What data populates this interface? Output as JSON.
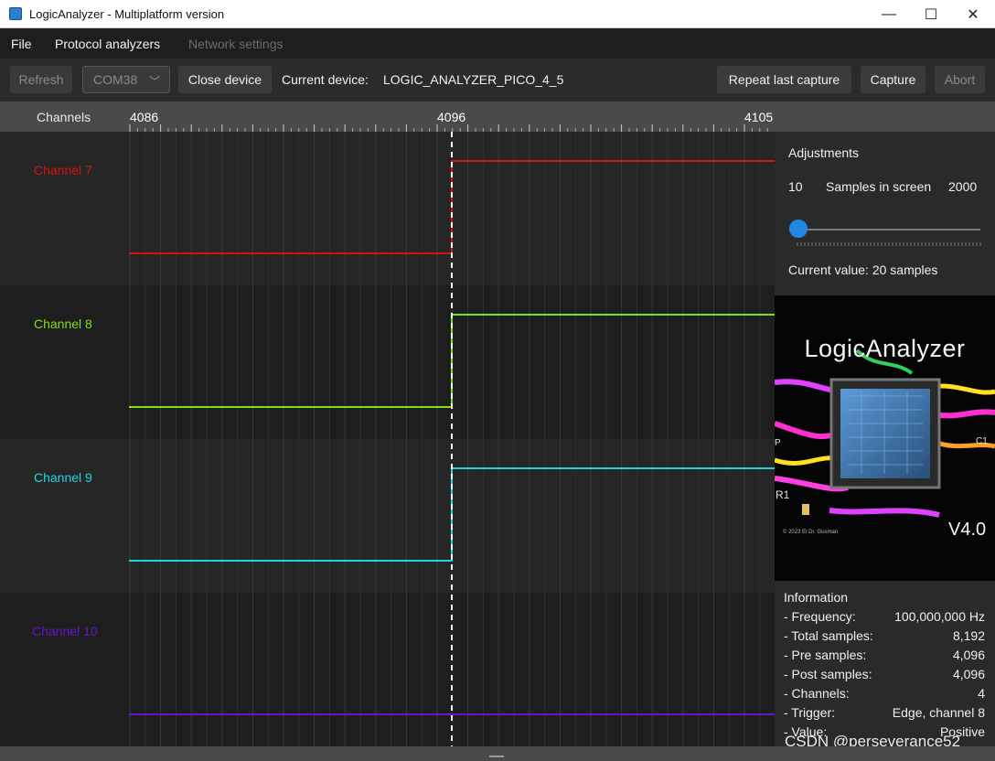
{
  "window": {
    "title": "LogicAnalyzer - Multiplatform version",
    "controls": {
      "minimize": "—",
      "maximize": "☐",
      "close": "✕"
    }
  },
  "menu": {
    "items": [
      {
        "label": "File",
        "enabled": true
      },
      {
        "label": "Protocol analyzers",
        "enabled": true
      },
      {
        "label": "Network settings",
        "enabled": false
      }
    ]
  },
  "toolbar": {
    "refresh_label": "Refresh",
    "port_value": "COM38",
    "close_device_label": "Close device",
    "current_device_label": "Current device:",
    "current_device_value": "LOGIC_ANALYZER_PICO_4_5",
    "repeat_capture_label": "Repeat last capture",
    "capture_label": "Capture",
    "abort_label": "Abort"
  },
  "ruler": {
    "channels_header": "Channels",
    "tick_labels": [
      "4086",
      "4096",
      "4105"
    ]
  },
  "channels": [
    {
      "label": "Channel 7",
      "color": "#d21414",
      "low_value": 0,
      "high_value": 1
    },
    {
      "label": "Channel 8",
      "color": "#7fe01c",
      "low_value": 0,
      "high_value": 1
    },
    {
      "label": "Channel 9",
      "color": "#1ed6e0",
      "low_value": 0,
      "high_value": 1
    },
    {
      "label": "Channel 10",
      "color": "#6a14c8",
      "low_value": 0,
      "high_value": 0
    }
  ],
  "trigger_marker_sample": "4096",
  "adjustments": {
    "heading": "Adjustments",
    "min": "10",
    "label": "Samples in screen",
    "max": "2000",
    "slider_fraction": 0.005,
    "current_label": "Current value:",
    "current_value": "20 samples"
  },
  "logo": {
    "title": "LogicAnalyzer",
    "version": "V4.0",
    "copyright": "© 2023 El Dr. Gusman",
    "r1": "R1",
    "c1": "C1",
    "p": "P"
  },
  "information": {
    "heading": "Information",
    "rows": [
      {
        "key": "- Frequency:",
        "value": "100,000,000 Hz"
      },
      {
        "key": "- Total samples:",
        "value": "8,192"
      },
      {
        "key": "- Pre samples:",
        "value": "4,096"
      },
      {
        "key": "- Post samples:",
        "value": "4,096"
      },
      {
        "key": "- Channels:",
        "value": "4"
      },
      {
        "key": "- Trigger:",
        "value": "Edge, channel 8"
      },
      {
        "key": "- Value:",
        "value": "Positive"
      }
    ]
  },
  "watermark": "CSDN @perseverance52",
  "colors": {
    "accent": "#1e88e5",
    "background": "#1e1e1e",
    "panel": "#2a2a2a"
  }
}
